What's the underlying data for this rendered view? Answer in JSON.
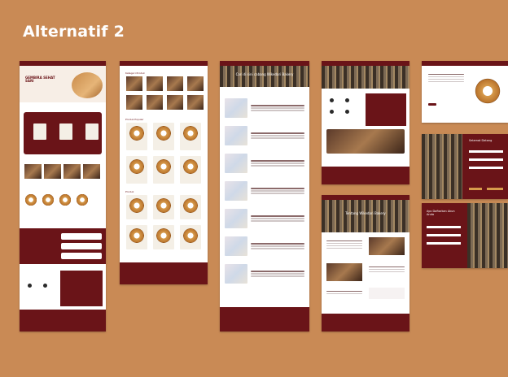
{
  "slide": {
    "title": "Alternatif 2"
  },
  "colors": {
    "background": "#c98a55",
    "brand": "#6a1418",
    "text_light": "#ffffff"
  },
  "pages": {
    "home": {
      "hero_title": "GEMBIRA SEHAT SARI",
      "nav_label": "SARI"
    },
    "catalog": {
      "section1": "Kategori Produk",
      "section2": "Produk Populer",
      "section3": "Produk"
    },
    "locations": {
      "hero_title": "Cari di sini cabang Wikedari Bakery"
    },
    "contact": {},
    "about": {
      "hero_title": "Tentang Wikedari Bakery"
    },
    "product_detail": {},
    "login": {
      "title": "Selamat Datang"
    },
    "register": {
      "title": "Ayo Daftarkan Akun Anda"
    }
  }
}
